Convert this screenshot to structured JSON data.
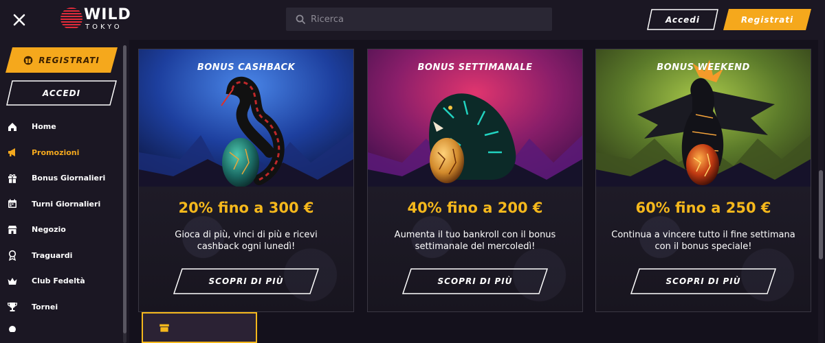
{
  "header": {
    "logo_main": "WILD",
    "logo_sub": "TOKYO",
    "search_placeholder": "Ricerca",
    "login_label": "Accedi",
    "register_label": "Registrati"
  },
  "sidebar": {
    "register_label": "REGISTRATI",
    "login_label": "ACCEDI",
    "items": [
      {
        "label": "Home",
        "icon": "home-icon",
        "active": false
      },
      {
        "label": "Promozioni",
        "icon": "megaphone-icon",
        "active": true
      },
      {
        "label": "Bonus Giornalieri",
        "icon": "gift-icon",
        "active": false
      },
      {
        "label": "Turni Giornalieri",
        "icon": "calendar-icon",
        "active": false
      },
      {
        "label": "Negozio",
        "icon": "shop-icon",
        "active": false
      },
      {
        "label": "Traguardi",
        "icon": "medal-icon",
        "active": false
      },
      {
        "label": "Club Fedeltà",
        "icon": "crown-icon",
        "active": false
      },
      {
        "label": "Tornei",
        "icon": "trophy-icon",
        "active": false
      }
    ]
  },
  "cards": [
    {
      "title": "BONUS CASHBACK",
      "offer": "20% fino a 300 €",
      "description": "Gioca di più, vinci di più e ricevi cashback ogni lunedì!",
      "button": "SCOPRI DI PIÙ",
      "art": "snake-illustration"
    },
    {
      "title": "BONUS SETTIMANALE",
      "offer": "40% fino a 200 €",
      "description": "Aumenta il tuo bankroll con il bonus settimanale del mercoledì!",
      "button": "SCOPRI DI PIÙ",
      "art": "tiger-illustration"
    },
    {
      "title": "BONUS WEEKEND",
      "offer": "60% fino a 250 €",
      "description": "Continua a vincere tutto il fine settimana con il bonus speciale!",
      "button": "SCOPRI DI PIÙ",
      "art": "dragon-illustration"
    }
  ],
  "colors": {
    "accent": "#f5b81c",
    "active_nav": "#f3a81e",
    "background": "#14111c",
    "panel": "#1b1723"
  }
}
